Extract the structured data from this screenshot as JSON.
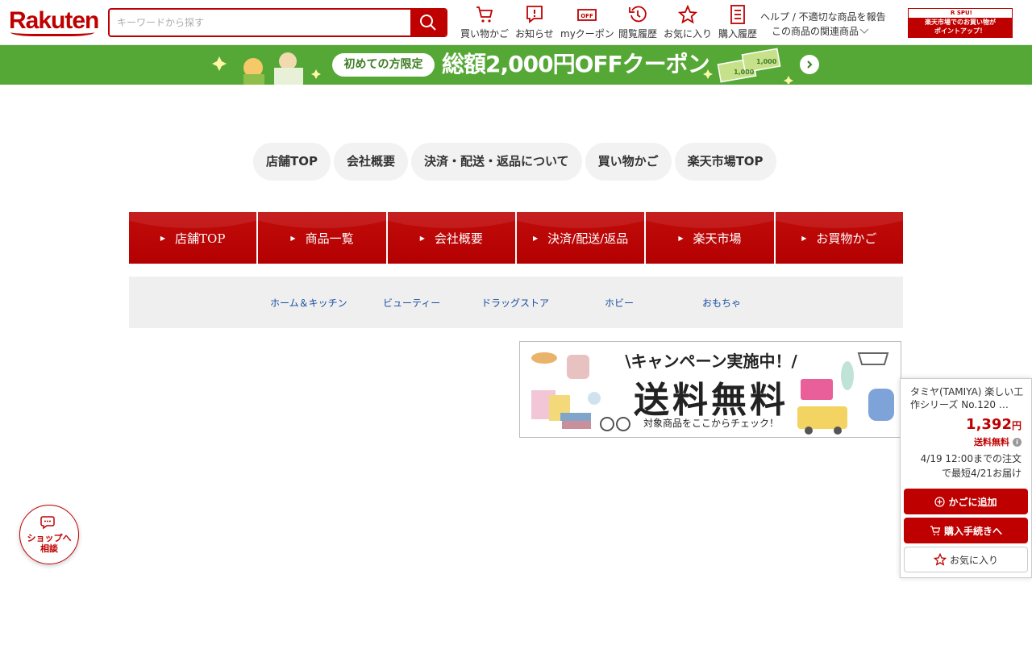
{
  "header": {
    "logo": "Rakuten",
    "search_placeholder": "キーワードから探す",
    "nav": [
      {
        "label": "買い物かご",
        "icon": "cart-icon"
      },
      {
        "label": "お知らせ",
        "icon": "notification-icon"
      },
      {
        "label": "myクーポン",
        "icon": "coupon-icon"
      },
      {
        "label": "閲覧履歴",
        "icon": "history-icon"
      },
      {
        "label": "お気に入り",
        "icon": "star-icon"
      },
      {
        "label": "購入履歴",
        "icon": "receipt-icon"
      }
    ],
    "help_line1": "ヘルプ / 不適切な商品を報告",
    "help_line2": "この商品の関連商品",
    "spu_top": "R SPU!",
    "spu_line1": "楽天市場でのお買い物が",
    "spu_line2": "ポイントアップ！"
  },
  "banner": {
    "pill": "初めての方限定",
    "text": "総額2,000円OFFクーポン"
  },
  "shop_nav": [
    "店舗TOP",
    "会社概要",
    "決済・配送・返品について",
    "買い物かご",
    "楽天市場TOP"
  ],
  "red_nav": [
    "店舗TOP",
    "商品一覧",
    "会社概要",
    "決済/配送/返品",
    "楽天市場",
    "お買物かご"
  ],
  "categories": [
    "ホーム＆キッチン",
    "ビューティー",
    "ドラッグストア",
    "ホビー",
    "おもちゃ"
  ],
  "promo": {
    "headline": "\\キャンペーン実施中！/",
    "big": "送料無料",
    "foot": "対象商品をここからチェック！"
  },
  "consult": {
    "line1": "ショップへ",
    "line2": "相談"
  },
  "buybox": {
    "product_name": "タミヤ(TAMIYA) 楽しい工作シリーズ No.120 …",
    "price": "1,392",
    "currency": "円",
    "shipping": "送料無料",
    "delivery_line1": "4/19 12:00までの注文",
    "delivery_line2": "で最短4/21お届け",
    "add_cart": "かごに追加",
    "checkout": "購入手続きへ",
    "favorite": "お気に入り"
  },
  "colors": {
    "brand": "#bf0000",
    "banner": "#56a836",
    "link": "#1a4fa0"
  }
}
